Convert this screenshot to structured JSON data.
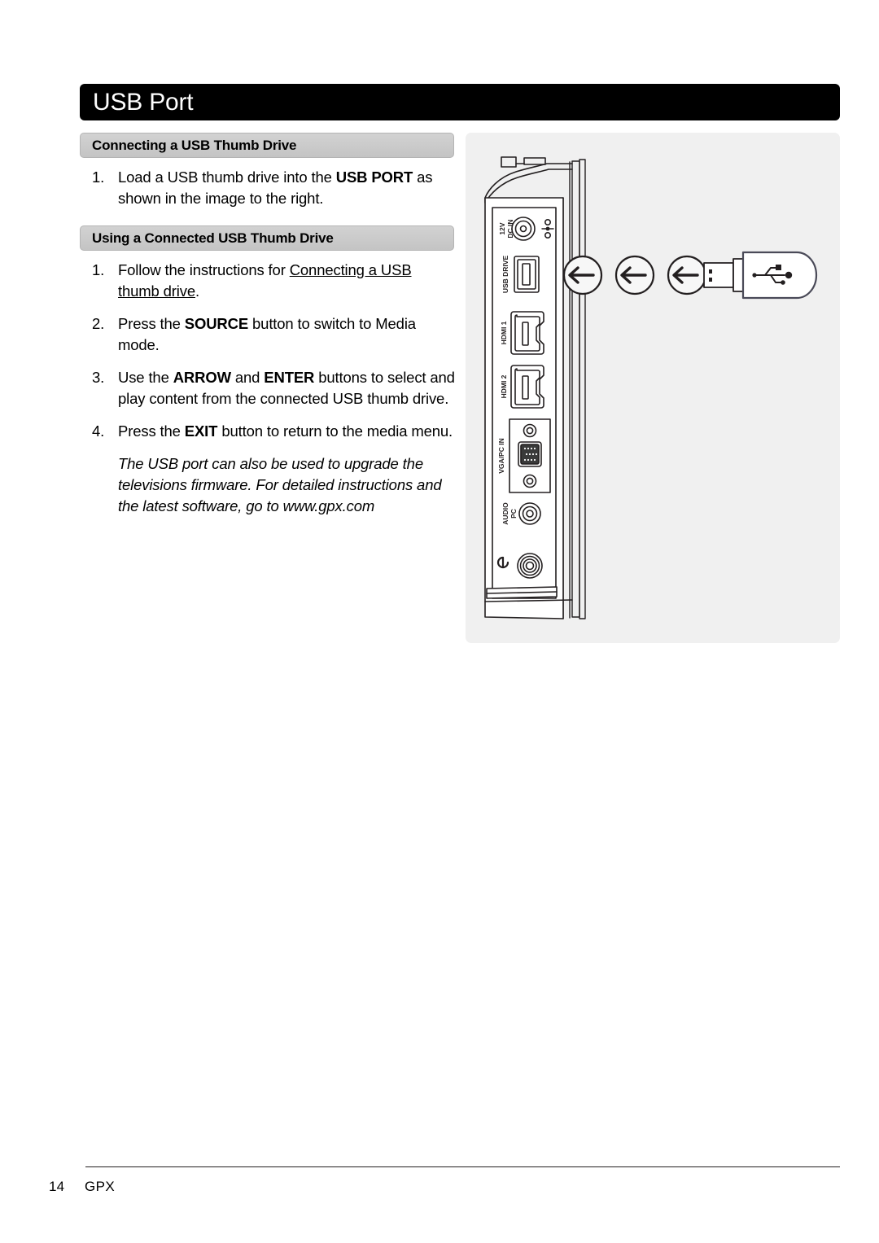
{
  "page": {
    "title": "USB Port",
    "footer_page_number": "14",
    "footer_brand": "GPX"
  },
  "sections": [
    {
      "heading": "Connecting a USB Thumb Drive",
      "steps": [
        {
          "number": "1.",
          "parts": [
            {
              "text": "Load a USB thumb drive into the ",
              "style": "normal"
            },
            {
              "text": "USB PORT",
              "style": "bold"
            },
            {
              "text": " as shown in the image to the right.",
              "style": "normal"
            }
          ]
        }
      ]
    },
    {
      "heading": "Using a Connected USB Thumb Drive",
      "steps": [
        {
          "number": "1.",
          "parts": [
            {
              "text": "Follow the instructions for ",
              "style": "normal"
            },
            {
              "text": "Connecting a USB thumb drive",
              "style": "underline"
            },
            {
              "text": ".",
              "style": "normal"
            }
          ]
        },
        {
          "number": "2.",
          "parts": [
            {
              "text": "Press the ",
              "style": "normal"
            },
            {
              "text": "SOURCE",
              "style": "bold"
            },
            {
              "text": " button to switch to Media mode.",
              "style": "normal"
            }
          ]
        },
        {
          "number": "3.",
          "parts": [
            {
              "text": "Use the ",
              "style": "normal"
            },
            {
              "text": "ARROW",
              "style": "bold"
            },
            {
              "text": " and ",
              "style": "normal"
            },
            {
              "text": "ENTER",
              "style": "bold"
            },
            {
              "text": " buttons to select and play content from the connected USB thumb drive.",
              "style": "normal"
            }
          ]
        },
        {
          "number": "4.",
          "parts": [
            {
              "text": "Press the ",
              "style": "normal"
            },
            {
              "text": "EXIT",
              "style": "bold"
            },
            {
              "text": " button to return to the media menu.",
              "style": "normal"
            }
          ]
        }
      ],
      "note": "The USB port can also be used to upgrade the televisions firmware. For detailed instructions and the latest software, go to www.gpx.com"
    }
  ],
  "illustration": {
    "description": "Side panel of television with connector ports and a USB thumb drive being inserted",
    "port_labels": [
      "DC IN 12V",
      "USB DRIVE",
      "HDMI 1",
      "HDMI 2",
      "VGA/PC IN",
      "PC AUDIO"
    ],
    "dc_in_label_line1": "DC IN",
    "dc_in_label_line2": "12V",
    "usb_drive_label": "USB DRIVE",
    "hdmi1_label": "HDMI 1",
    "hdmi2_label": "HDMI 2",
    "vga_label": "VGA/PC IN",
    "pc_audio_label_line1": "PC",
    "pc_audio_label_line2": "AUDIO",
    "arrow_count": 3,
    "arrow_direction": "left"
  },
  "colors": {
    "title_bar_bg": "#000000",
    "title_text": "#ffffff",
    "section_bar_bg": "#c8c8c8",
    "section_bar_border": "#b4b4b4",
    "panel_bg": "#f0f0f0",
    "body_text": "#000000",
    "rule": "#231f20"
  }
}
